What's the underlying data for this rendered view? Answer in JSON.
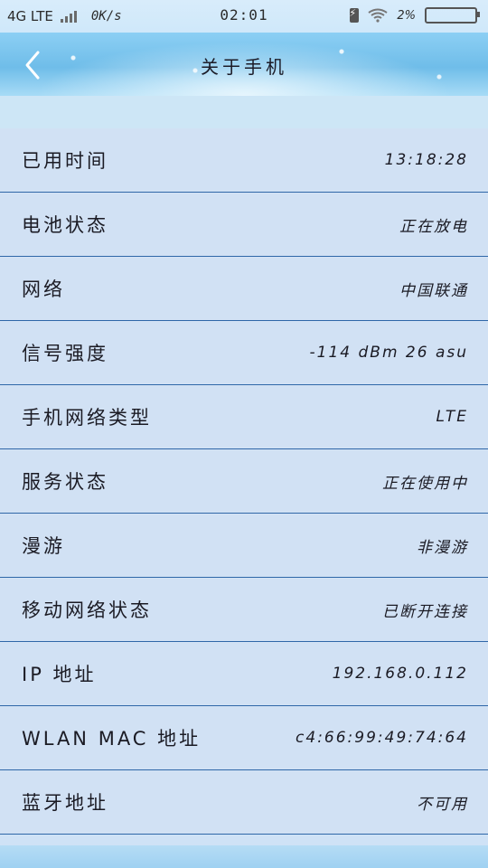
{
  "status_bar": {
    "network": "4G LTE",
    "speed": "0K/s",
    "time": "02:01",
    "battery_percent": "2%"
  },
  "header": {
    "title": "关于手机"
  },
  "rows": [
    {
      "label": "已用时间",
      "value": "13:18:28"
    },
    {
      "label": "电池状态",
      "value": "正在放电"
    },
    {
      "label": "网络",
      "value": "中国联通"
    },
    {
      "label": "信号强度",
      "value": "-114 dBm   26 asu"
    },
    {
      "label": "手机网络类型",
      "value": "LTE"
    },
    {
      "label": "服务状态",
      "value": "正在使用中"
    },
    {
      "label": "漫游",
      "value": "非漫游"
    },
    {
      "label": "移动网络状态",
      "value": "已断开连接"
    },
    {
      "label": "IP 地址",
      "value": "192.168.0.112"
    },
    {
      "label": "WLAN MAC 地址",
      "value": "c4:66:99:49:74:64"
    },
    {
      "label": "蓝牙地址",
      "value": "不可用"
    }
  ],
  "colors": {
    "header_blue": "#6fbde9",
    "row_background": "#d1e1f4",
    "divider": "#2f67a8"
  },
  "icons": [
    "back-chevron-icon",
    "signal-bars-icon",
    "charging-icon",
    "wifi-icon",
    "battery-icon"
  ]
}
